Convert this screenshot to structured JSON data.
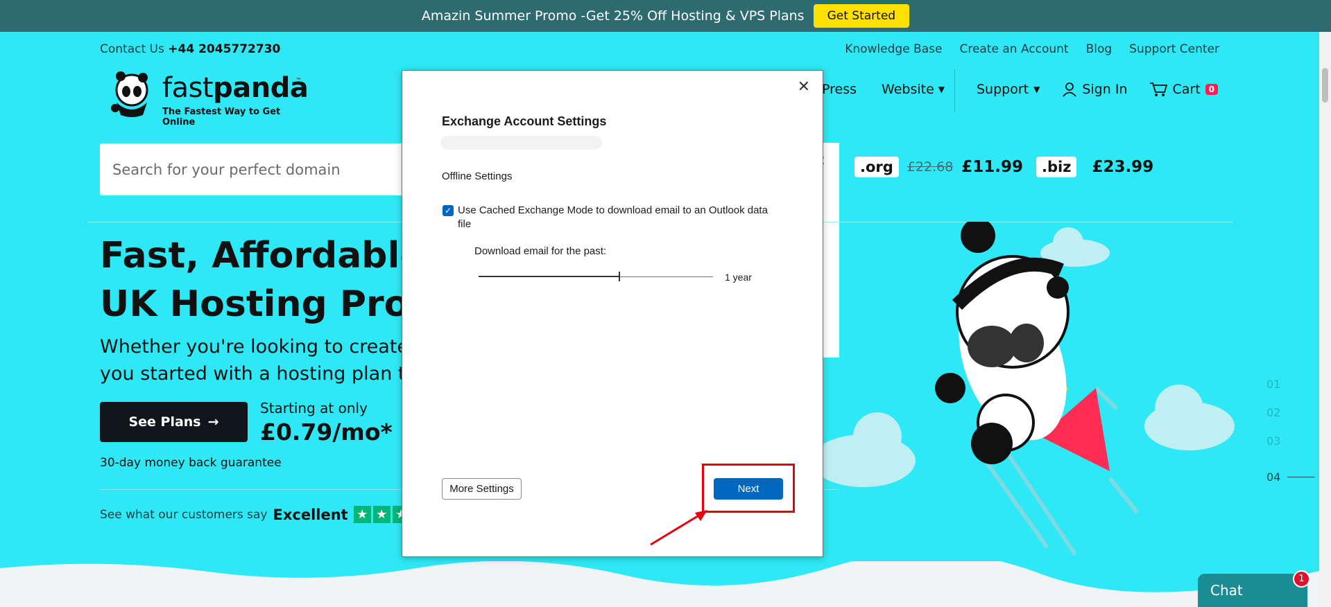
{
  "promo": {
    "text": "Amazin Summer Promo -Get 25% Off Hosting & VPS Plans",
    "button": "Get Started"
  },
  "header": {
    "contact_label": "Contact Us",
    "contact_phone": "+44 2045772730",
    "top_links": [
      "Knowledge Base",
      "Create an Account",
      "Blog",
      "Support Center"
    ],
    "logo_word_a": "fast",
    "logo_word_b": "panda",
    "logo_tm": "™",
    "logo_tagline": "The Fastest Way to Get Online",
    "nav": [
      {
        "label": "Press"
      },
      {
        "label": "Website"
      }
    ],
    "support": "Support",
    "sign_in": "Sign In",
    "cart": "Cart",
    "cart_count": "0"
  },
  "search": {
    "placeholder": "Search for your perfect domain",
    "clear": "✕"
  },
  "prices": [
    {
      "tld": ".org",
      "old": "£22.68",
      "price": "£11.99"
    },
    {
      "tld": ".biz",
      "old": "",
      "price": "£23.99"
    }
  ],
  "hero": {
    "line1": "Fast, Affordable, a",
    "line2": "UK Hosting Provic",
    "para1": "Whether you're looking to create a w",
    "para2": "you started with a hosting plan tailo",
    "cta": "See Plans",
    "starting": "Starting at only",
    "price": "£0.79/mo*",
    "guarantee": "30-day money back guarantee",
    "reviews_text": "See what our customers say",
    "reviews_rating": "Excellent"
  },
  "slides": [
    "01",
    "02",
    "03",
    "04"
  ],
  "chat": {
    "label": "Chat",
    "badge": "1"
  },
  "dialog": {
    "title": "Exchange Account Settings",
    "section": "Offline Settings",
    "checkbox_label": "Use Cached Exchange Mode to download email to an Outlook data file",
    "checkbox_checked": true,
    "download_label": "Download email for the past:",
    "slider_value_text": "1 year",
    "slider_fraction": 0.6,
    "more_settings": "More Settings",
    "next": "Next",
    "close": "✕"
  },
  "colors": {
    "background": "#2ee9f5",
    "promo_bar": "#2e6b71",
    "promo_button": "#ffe100",
    "primary_button": "#0067c0",
    "highlight": "#e8000e",
    "trustpilot": "#00b67a"
  }
}
